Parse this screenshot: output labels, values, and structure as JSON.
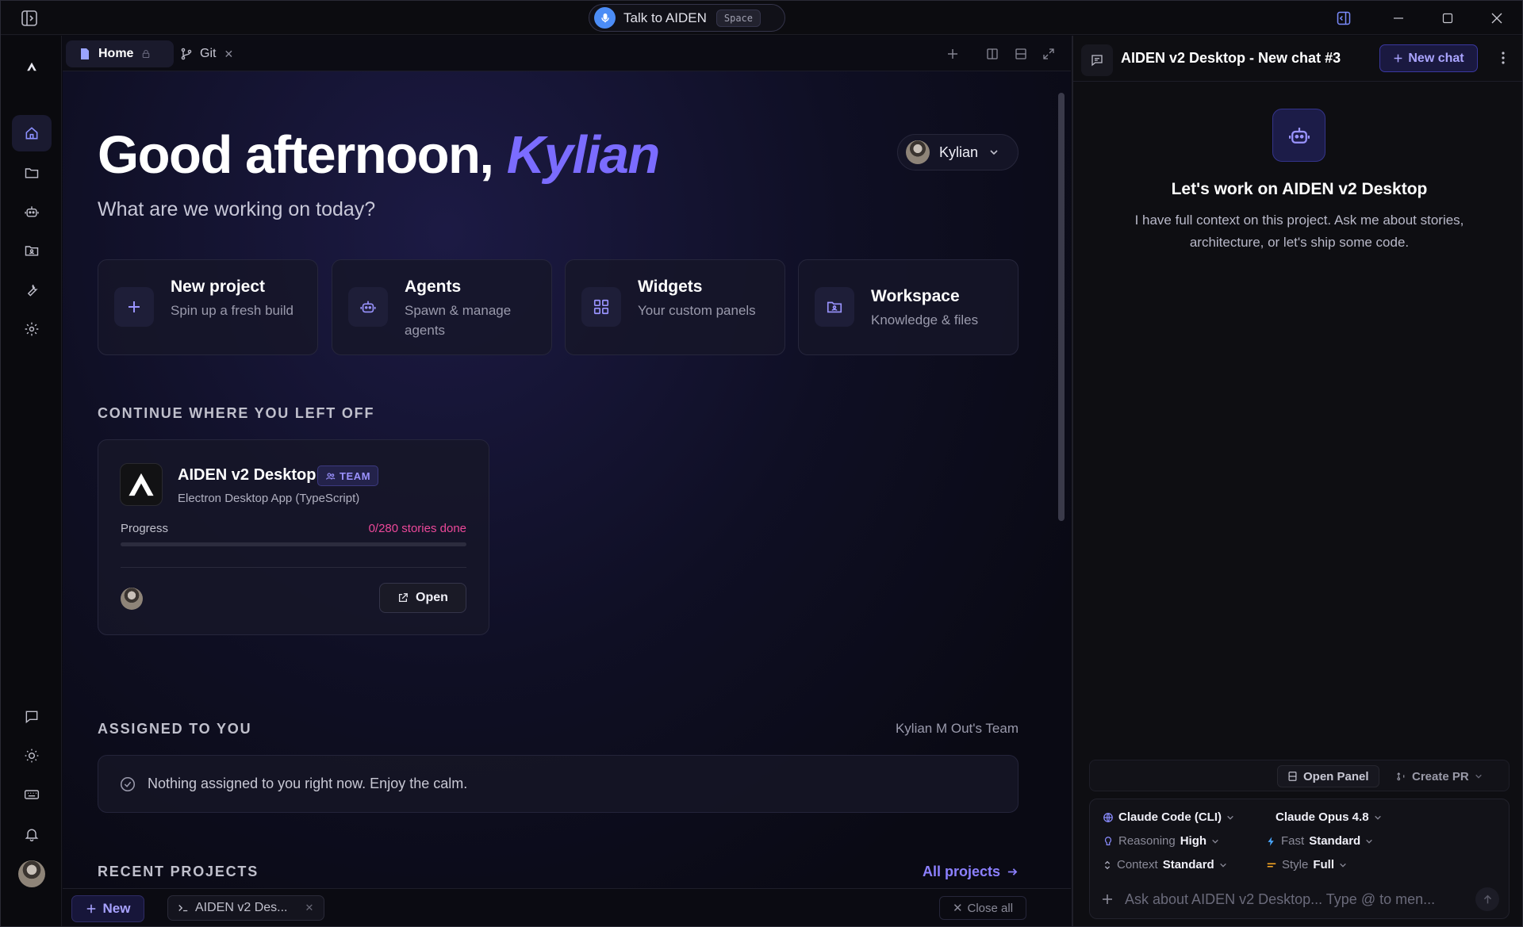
{
  "titlebar": {
    "talk_label": "Talk to AIDEN",
    "talk_shortcut": "Space"
  },
  "tabs": {
    "home_label": "Home",
    "git_label": "Git"
  },
  "main": {
    "greeting": "Good afternoon,",
    "greeting_name": "Kylian",
    "subtitle": "What are we working on today?",
    "user_menu_name": "Kylian"
  },
  "quick_actions": [
    {
      "title": "New project",
      "desc": "Spin up a fresh build",
      "icon": "plus-icon"
    },
    {
      "title": "Agents",
      "desc": "Spawn & manage agents",
      "icon": "robot-icon"
    },
    {
      "title": "Widgets",
      "desc": "Your custom panels",
      "icon": "grid-icon"
    },
    {
      "title": "Workspace",
      "desc": "Knowledge & files",
      "icon": "folder-icon"
    }
  ],
  "continue": {
    "heading": "CONTINUE WHERE YOU LEFT OFF",
    "project": {
      "name": "AIDEN v2 Desktop",
      "badge": "TEAM",
      "subtitle": "Electron Desktop App (TypeScript)",
      "progress_label": "Progress",
      "progress_text": "0/280 stories done",
      "progress_fraction": 0,
      "open_label": "Open"
    }
  },
  "assigned": {
    "heading": "ASSIGNED TO YOU",
    "team": "Kylian M Out's Team",
    "empty_message": "Nothing assigned to you right now. Enjoy the calm."
  },
  "recent": {
    "heading": "RECENT PROJECTS",
    "all_link": "All projects"
  },
  "bottombar": {
    "new_label": "New",
    "terminal_tab": "AIDEN v2 Des...",
    "close_all": "Close all"
  },
  "chat": {
    "title": "AIDEN v2 Desktop - New chat #3",
    "new_chat_label": "New chat",
    "heading": "Let's work on AIDEN v2 Desktop",
    "description": "I have full context on this project. Ask me about stories, architecture, or let's ship some code.",
    "open_panel": "Open Panel",
    "create_pr": "Create PR",
    "provider": "Claude Code (CLI)",
    "model": "Claude Opus 4.8",
    "reasoning_label": "Reasoning",
    "reasoning_value": "High",
    "fast_label": "Fast",
    "fast_value": "Standard",
    "context_label": "Context",
    "context_value": "Standard",
    "style_label": "Style",
    "style_value": "Full",
    "input_placeholder": "Ask about AIDEN v2 Desktop... Type @ to men..."
  },
  "colors": {
    "accent": "#7b6cff",
    "progress": "#ec4899",
    "background": "#0b0b12"
  }
}
